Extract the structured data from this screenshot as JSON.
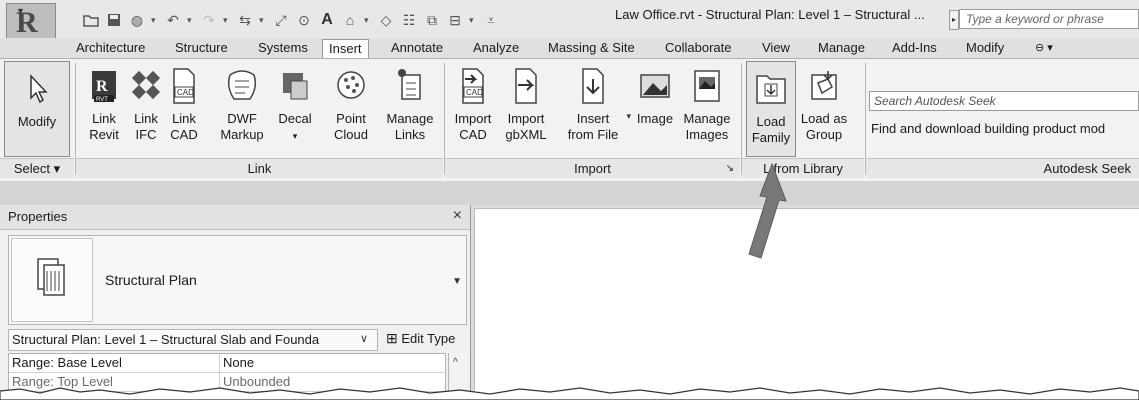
{
  "window": {
    "title": "Law Office.rvt - Structural Plan: Level 1 – Structural ...",
    "search_placeholder": "Type a keyword or phrase"
  },
  "tabs": [
    "Architecture",
    "Structure",
    "Systems",
    "Insert",
    "Annotate",
    "Analyze",
    "Massing & Site",
    "Collaborate",
    "View",
    "Manage",
    "Add-Ins",
    "Modify"
  ],
  "active_tab": "Insert",
  "ribbon": {
    "modify": {
      "label": "Modify",
      "panel": "Select ▾"
    },
    "link": {
      "panel": "Link",
      "buttons": [
        {
          "label": "Link\nRevit",
          "icon": "link-revit-icon"
        },
        {
          "label": "Link\nIFC",
          "icon": "link-ifc-icon"
        },
        {
          "label": "Link\nCAD",
          "icon": "link-cad-icon"
        },
        {
          "label": "DWF\nMarkup",
          "icon": "dwf-markup-icon"
        },
        {
          "label": "Decal",
          "icon": "decal-icon"
        },
        {
          "label": "Point\nCloud",
          "icon": "point-cloud-icon"
        },
        {
          "label": "Manage\nLinks",
          "icon": "manage-links-icon"
        }
      ]
    },
    "import": {
      "panel": "Import",
      "buttons": [
        {
          "label": "Import\nCAD",
          "icon": "import-cad-icon"
        },
        {
          "label": "Import\ngbXML",
          "icon": "import-gbxml-icon"
        },
        {
          "label": "Insert\nfrom File",
          "icon": "insert-from-file-icon"
        },
        {
          "label": "Image",
          "icon": "image-icon"
        },
        {
          "label": "Manage\nImages",
          "icon": "manage-images-icon"
        }
      ]
    },
    "load_from_library": {
      "panel": "L    from Library",
      "buttons": [
        {
          "label": "Load\nFamily",
          "icon": "load-family-icon"
        },
        {
          "label": "Load as\nGroup",
          "icon": "load-as-group-icon"
        }
      ]
    },
    "autodesk_seek": {
      "panel": "Autodesk Seek",
      "search_placeholder": "Search Autodesk Seek",
      "description": "Find and download building product mod"
    }
  },
  "properties": {
    "title": "Properties",
    "type_name": "Structural Plan",
    "instance_selector": "Structural Plan: Level 1 – Structural Slab and Founda",
    "edit_type": "Edit Type",
    "rows": [
      {
        "name": "Range: Base Level",
        "value": "None"
      },
      {
        "name": "Range: Top Level",
        "value": "Unbounded"
      }
    ]
  },
  "colors": {
    "arrow": "#787878",
    "ribbon_bg": "#f2f2f2",
    "tab_bar": "#e0e0e0"
  }
}
